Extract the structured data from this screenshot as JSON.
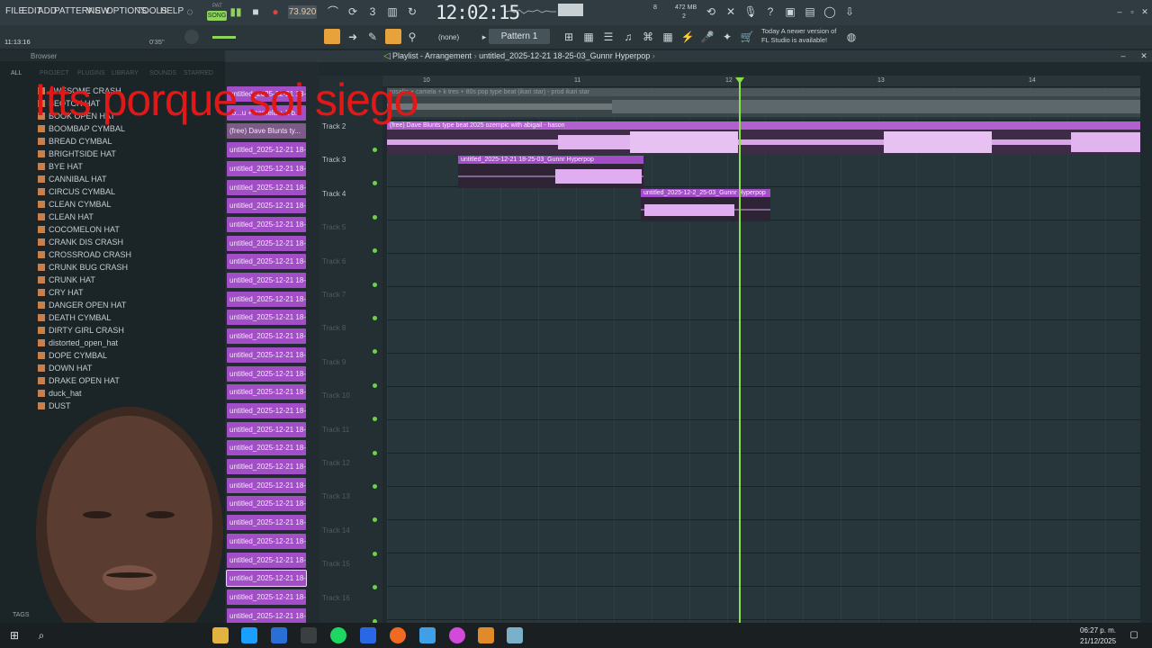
{
  "menu": [
    "FILE",
    "EDIT",
    "ADD",
    "PATTERNS",
    "VIEW",
    "OPTIONS",
    "TOOLS",
    "HELP"
  ],
  "transport": {
    "mode": "SONG",
    "pattern_label": "PAT",
    "bpm": "73.920",
    "clock": "12:02:15",
    "memory": "472 MB",
    "cpu_value": "8",
    "voices": "2"
  },
  "status": {
    "time": "11:13:16",
    "position": "0'35\""
  },
  "toolbar2": {
    "snap": "(none)",
    "pattern": "Pattern 1"
  },
  "news": {
    "when": "Today",
    "line1": "A newer version of",
    "line2": "FL Studio is available!"
  },
  "browser": {
    "title": "Browser",
    "categories": [
      "ALL",
      "PROJECT",
      "PLUGINS",
      "LIBRARY",
      "SOUNDS",
      "STARRED"
    ],
    "items": [
      "AWESOME CRASH",
      "BEOTCH HAT",
      "BOOK OPEN HAT",
      "BOOMBAP CYMBAL",
      "BREAD CYMBAL",
      "BRIGHTSIDE HAT",
      "BYE HAT",
      "CANNIBAL HAT",
      "CIRCUS CYMBAL",
      "CLEAN CYMBAL",
      "CLEAN HAT",
      "COCOMELON HAT",
      "CRANK DIS CRASH",
      "CROSSROAD CRASH",
      "CRUNK BUG CRASH",
      "CRUNK HAT",
      "CRY HAT",
      "DANGER OPEN HAT",
      "DEATH CYMBAL",
      "DIRTY GIRL CRASH",
      "distorted_open_hat",
      "DOPE CYMBAL",
      "DOWN HAT",
      "DRAKE OPEN HAT",
      "duck_hat",
      "DUST"
    ],
    "tags_label": "TAGS"
  },
  "channels": [
    "untitled_2025-12-21 18-",
    "ro...u + camela + k b...",
    "(free) Dave Blunts ty...",
    "untitled_2025-12-21 18-",
    "untitled_2025-12-21 18-",
    "untitled_2025-12-21 18-",
    "untitled_2025-12-21 18-",
    "untitled_2025-12-21 18-",
    "untitled_2025-12-21 18-",
    "untitled_2025-12-21 18-",
    "untitled_2025-12-21 18-",
    "untitled_2025-12-21 18-",
    "untitled_2025-12-21 18-",
    "untitled_2025-12-21 18-",
    "untitled_2025-12-21 18-",
    "untitled_2025-12-21 18-",
    "untitled_2025-12-21 18-",
    "untitled_2025-12-21 18-",
    "untitled_2025-12-21 18-",
    "untitled_2025-12-21 18-",
    "untitled_2025-12-21 18-",
    "untitled_2025-12-21 18-",
    "untitled_2025-12-21 18-",
    "untitled_2025-12-21 18-",
    "untitled_2025-12-21 18-",
    "untitled_2025-12-21 18-",
    "untitled_2025-12-21 18-",
    "untitled_2025-12-21 18-",
    "untitled_2025-12-21 18-"
  ],
  "playlist": {
    "window_label": "Playlist - Arrangement",
    "arrangement": "untitled_2025-12-21 18-25-03_Gunnr Hyperpop",
    "ruler": [
      "10",
      "11",
      "12",
      "13",
      "14"
    ],
    "tracks": [
      "Track 2",
      "Track 3",
      "Track 4",
      "Track 5",
      "Track 6",
      "Track 7",
      "Track 8",
      "Track 9",
      "Track 10",
      "Track 11",
      "Track 12",
      "Track 13",
      "Track 14",
      "Track 15",
      "Track 16"
    ],
    "clips": [
      "rosalía + camela + k tres + 80s pop type beat (ikari star) - prod ikari star",
      "(free) Dave Blunts type beat 2025 ozempic with abigail - hason",
      "untitled_2025-12-21 18-25-03_Gunnr Hyperpop",
      "untitled_2025-12-2_25-03_Gunnr Hyperpop"
    ]
  },
  "overlay_caption": "Itts porque soi siego",
  "taskbar": {
    "time": "06:27 p. m.",
    "date": "21/12/2025"
  },
  "colors": {
    "accent": "#a24fc7",
    "playhead": "#8be04a",
    "clip_head": "#b25fd0",
    "overlay": "#e01818"
  }
}
